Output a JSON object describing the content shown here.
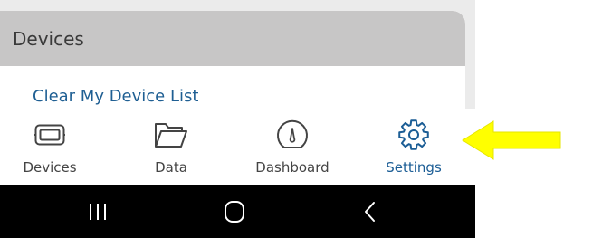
{
  "card": {
    "title": "Devices",
    "link": "Clear My Device List"
  },
  "tabs": [
    {
      "label": "Devices",
      "icon": "battery-device-icon",
      "active": false
    },
    {
      "label": "Data",
      "icon": "folder-icon",
      "active": false
    },
    {
      "label": "Dashboard",
      "icon": "gauge-icon",
      "active": false
    },
    {
      "label": "Settings",
      "icon": "gear-icon",
      "active": true
    }
  ],
  "android_nav": {
    "buttons": [
      "recent-apps",
      "home",
      "back"
    ]
  },
  "colors": {
    "accent": "#1b5d95",
    "link": "#1f5f93",
    "header_bg": "#c7c6c6",
    "annotation_arrow": "#ffff00"
  }
}
